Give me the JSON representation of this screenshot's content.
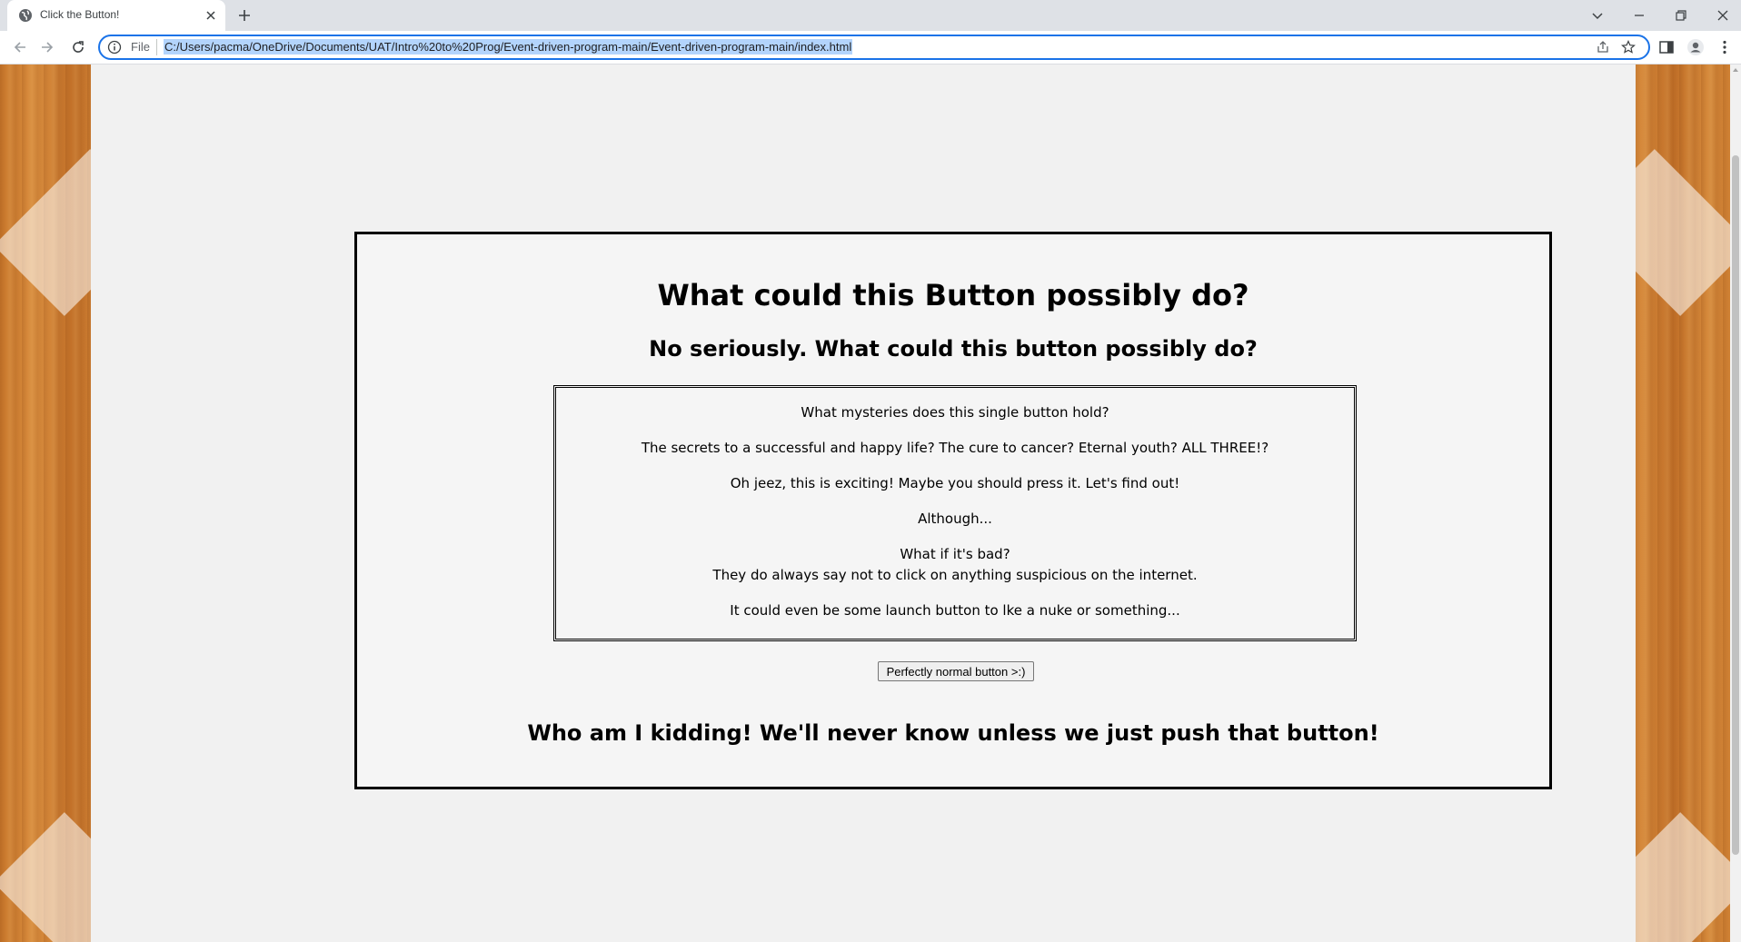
{
  "browser": {
    "tab_title": "Click the Button!",
    "address_scheme": "File",
    "url": "C:/Users/pacma/OneDrive/Documents/UAT/Intro%20to%20Prog/Event-driven-program-main/Event-driven-program-main/index.html"
  },
  "page": {
    "title": "What could this Button possibly do?",
    "subtitle": "No seriously. What could this button possibly do?",
    "paragraphs": [
      "What mysteries does this single button hold?",
      "The secrets to a successful and happy life? The cure to cancer? Eternal youth? ALL THREE!?",
      "Oh jeez, this is exciting! Maybe you should press it. Let's find out!",
      "Although...",
      "What if it's bad?",
      "They do always say not to click on anything suspicious on the internet.",
      "It could even be some launch button to lke a nuke or something..."
    ],
    "button_label": "Perfectly normal button >:)",
    "footer": "Who am I kidding! We'll never know unless we just push that button!"
  },
  "icons": {
    "tab_favicon": "globe-icon",
    "tab_close": "close-icon",
    "new_tab": "plus-icon",
    "back": "arrow-left-icon",
    "forward": "arrow-right-icon",
    "reload": "reload-icon",
    "site_info": "info-icon",
    "share": "share-icon",
    "bookmark": "star-icon",
    "side_panel": "side-panel-icon",
    "profile": "profile-icon",
    "menu": "kebab-menu-icon"
  },
  "colors": {
    "focus_ring": "#1a73e8",
    "url_selection": "#b3d4fc",
    "wood": "#c9782c",
    "paper": "#f1f1f1"
  }
}
